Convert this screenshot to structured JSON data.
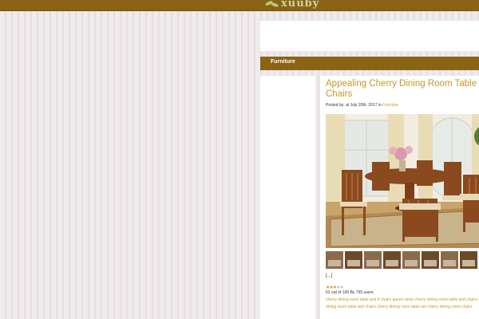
{
  "header": {
    "logo_text": "xuuby",
    "colors": {
      "bar": "#8a6414",
      "logo": "#cfd6a2"
    }
  },
  "category_bar": {
    "label": "Furniture"
  },
  "post": {
    "title": "Appealing Cherry Dining Room Table And Chairs",
    "meta_prefix": "Posted by:  at July 20th, 2017 in ",
    "category": "Furniture",
    "image_alt": "cherry dining room table and chairs",
    "thumbnail_count": 8,
    "excerpt": "[...]",
    "rating": {
      "value": 2.5,
      "max": 5
    },
    "votes_text": "52 out of 100 By 765 users",
    "tags": [
      "cherry dining room table and 6 chairs",
      "queen anne cherry dining room table and chairs",
      "cherry dining room table and chairs",
      "cherry dining room table set",
      "cherry dining room chairs"
    ],
    "colors": {
      "link": "#c8962a"
    }
  }
}
